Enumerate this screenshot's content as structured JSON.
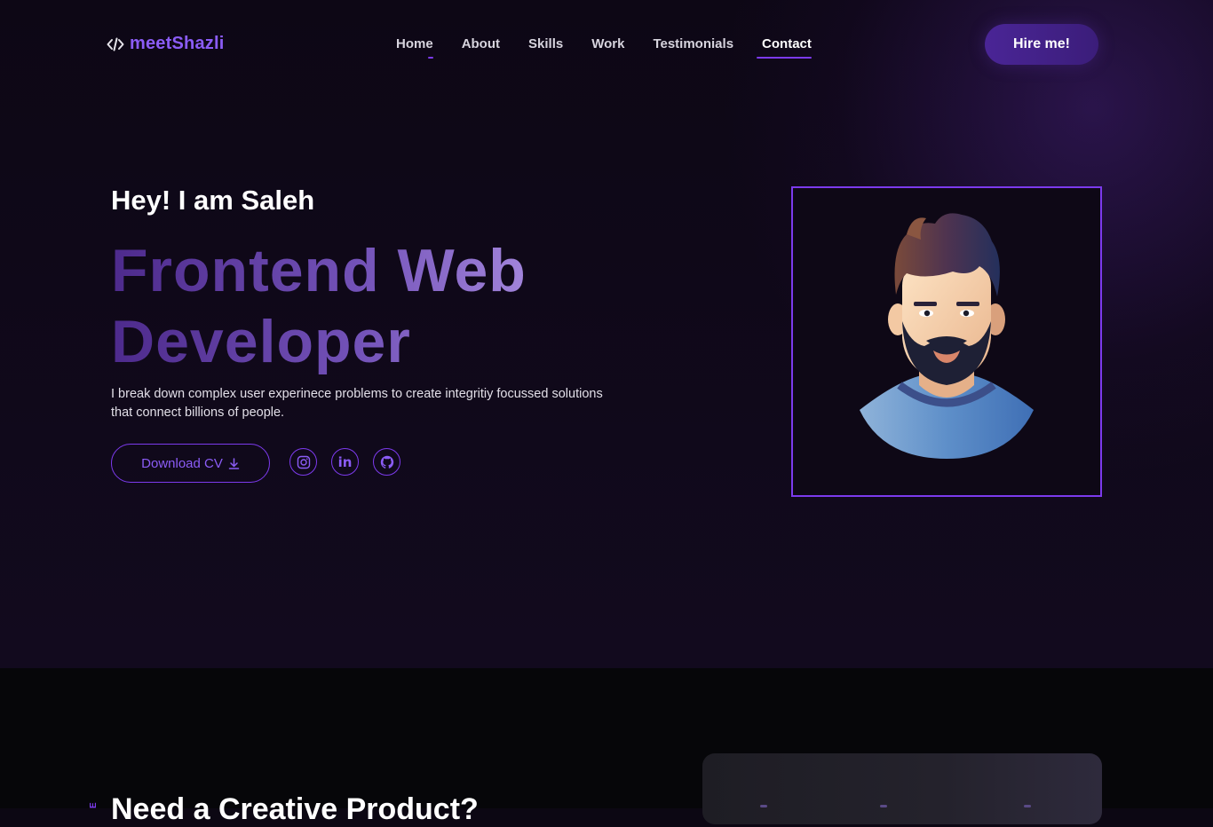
{
  "brand": {
    "logo_text": "meetShazli",
    "logo_icon": "code-icon",
    "accent": "#7c3aed"
  },
  "nav": {
    "items": [
      {
        "label": "Home"
      },
      {
        "label": "About"
      },
      {
        "label": "Skills"
      },
      {
        "label": "Work"
      },
      {
        "label": "Testimonials"
      },
      {
        "label": "Contact"
      }
    ],
    "active": "Contact",
    "hire_label": "Hire me!"
  },
  "hero": {
    "greeting": "Hey! I am Saleh",
    "headline": "Frontend Web Developer",
    "description": "I break down complex user experinece problems to create integritiy focussed solutions that connect billions of people.",
    "cv_label": "Download CV",
    "social": [
      {
        "icon": "instagram-icon"
      },
      {
        "icon": "linkedin-icon",
        "text": "in"
      },
      {
        "icon": "github-icon"
      }
    ]
  },
  "lower": {
    "title": "Need a Creative Product?",
    "side_label": "E"
  }
}
